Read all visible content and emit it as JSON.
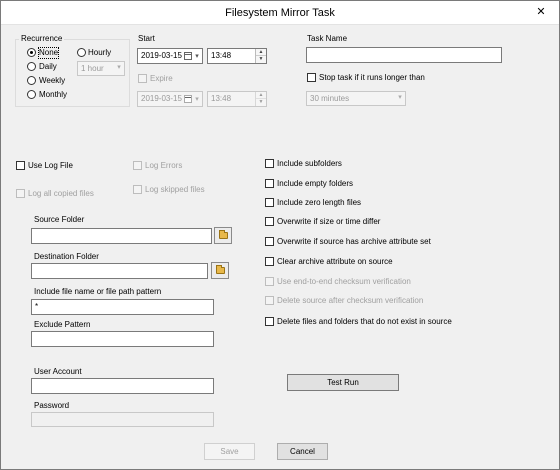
{
  "window": {
    "title": "Filesystem Mirror Task",
    "close_glyph": "✕"
  },
  "recurrence": {
    "legend": "Recurrence",
    "options": {
      "none": "None",
      "daily": "Daily",
      "weekly": "Weekly",
      "monthly": "Monthly",
      "hourly": "Hourly"
    },
    "selected": "None",
    "hourly_interval": "1 hour"
  },
  "start": {
    "label": "Start",
    "date": "2019-03-15",
    "time": "13:48",
    "expire_label": "Expire",
    "expire_date": "2019-03-15",
    "expire_time": "13:48"
  },
  "task": {
    "name_label": "Task Name",
    "name_value": "",
    "stop_label": "Stop task if it runs longer than",
    "stop_duration": "30 minutes"
  },
  "logging": {
    "use_log_file": "Use Log File",
    "log_errors": "Log Errors",
    "log_all_copied": "Log all copied files",
    "log_skipped": "Log skipped files"
  },
  "paths": {
    "source_label": "Source Folder",
    "source_value": "",
    "destination_label": "Destination Folder",
    "destination_value": "",
    "include_label": "Include file name or file path pattern",
    "include_value": "*",
    "exclude_label": "Exclude Pattern",
    "exclude_value": ""
  },
  "account": {
    "user_label": "User Account",
    "user_value": "",
    "password_label": "Password",
    "password_value": ""
  },
  "options": {
    "include_subfolders": "Include subfolders",
    "include_empty_folders": "Include empty folders",
    "include_zero_length": "Include zero length files",
    "overwrite_size_time": "Overwrite if size or time differ",
    "overwrite_archive": "Overwrite if source has archive attribute set",
    "clear_archive": "Clear archive attribute on source",
    "use_checksum": "Use end-to-end checksum verification",
    "delete_after_checksum": "Delete source after checksum verification",
    "delete_not_in_source": "Delete files and folders that do not exist in source"
  },
  "buttons": {
    "test_run": "Test Run",
    "save": "Save",
    "cancel": "Cancel"
  },
  "icons": {
    "folder": "folder-icon",
    "calendar": "calendar-icon",
    "close": "close-icon"
  },
  "colors": {
    "title_bar": "#ffffff",
    "dialog_bg": "#f0f0f0",
    "folder_icon": "#e8b84a"
  }
}
